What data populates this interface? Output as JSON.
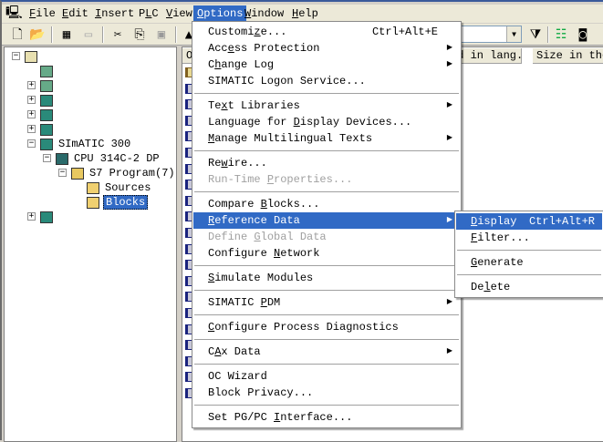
{
  "menubar": [
    "&File",
    "&Edit",
    "&Insert",
    "P&LC",
    "&View",
    "&Options",
    "&Window",
    "&Help"
  ],
  "active_menu": "Options",
  "toolbar": {
    "filter_value": ""
  },
  "tree": {
    "items": [
      {
        "label": "",
        "level": 0,
        "exp": "-",
        "icon": "project-icon"
      },
      {
        "label": "",
        "level": 1,
        "exp": "",
        "icon": "network-icon"
      },
      {
        "label": "",
        "level": 1,
        "exp": "+",
        "icon": "network-icon"
      },
      {
        "label": "",
        "level": 1,
        "exp": "+",
        "icon": "station-icon"
      },
      {
        "label": "",
        "level": 1,
        "exp": "+",
        "icon": "station-icon"
      },
      {
        "label": "",
        "level": 1,
        "exp": "+",
        "icon": "station-icon"
      },
      {
        "label": "SImATIC 300",
        "level": 1,
        "exp": "-",
        "icon": "station-icon"
      },
      {
        "label": "CPU 314C-2 DP",
        "level": 2,
        "exp": "-",
        "icon": "cpu-icon"
      },
      {
        "label": "S7 Program(7)",
        "level": 3,
        "exp": "-",
        "icon": "s7-program-icon"
      },
      {
        "label": "Sources",
        "level": 4,
        "exp": "",
        "icon": "sources-folder-icon"
      },
      {
        "label": "Blocks",
        "level": 4,
        "exp": "",
        "icon": "blocks-folder-icon",
        "selected": true
      },
      {
        "label": "",
        "level": 1,
        "exp": "+",
        "icon": "station-icon"
      }
    ]
  },
  "list": {
    "columns": [
      "OT",
      "ed in lang...",
      "Size in the"
    ],
    "rows": 21
  },
  "options_menu": [
    {
      "label": "Customi&ze...",
      "shortcut": "Ctrl+Alt+E"
    },
    {
      "label": "Acc&ess Protection",
      "submenu": true
    },
    {
      "label": "C&hange Log",
      "submenu": true
    },
    {
      "label": "SIMATIC Logon Service..."
    },
    {
      "sep": true
    },
    {
      "label": "Te&xt Libraries",
      "submenu": true
    },
    {
      "label": "Language for &Display Devices..."
    },
    {
      "label": "&Manage Multilingual Texts",
      "submenu": true
    },
    {
      "sep": true
    },
    {
      "label": "Re&wire..."
    },
    {
      "label": "Run-Time &Properties...",
      "disabled": true
    },
    {
      "sep": true
    },
    {
      "label": "Compare &Blocks..."
    },
    {
      "label": "&Reference Data",
      "submenu": true,
      "highlighted": true
    },
    {
      "label": "Define &Global Data",
      "disabled": true
    },
    {
      "label": "Configure &Network"
    },
    {
      "sep": true
    },
    {
      "label": "&Simulate Modules"
    },
    {
      "sep": true
    },
    {
      "label": "SIMATIC &PDM",
      "submenu": true
    },
    {
      "sep": true
    },
    {
      "label": "&Configure Process Diagnostics"
    },
    {
      "sep": true
    },
    {
      "label": "C&Ax Data",
      "submenu": true
    },
    {
      "sep": true
    },
    {
      "label": "OC Wizard"
    },
    {
      "label": "Block Privacy..."
    },
    {
      "sep": true
    },
    {
      "label": "Set PG/PC &Interface..."
    }
  ],
  "reference_submenu": [
    {
      "label": "&Display",
      "shortcut": "Ctrl+Alt+R",
      "highlighted": true
    },
    {
      "label": "&Filter..."
    },
    {
      "sep": true
    },
    {
      "label": "&Generate"
    },
    {
      "sep": true
    },
    {
      "label": "De&lete"
    }
  ],
  "colors": {
    "highlight": "#316ac5",
    "menubar": "#ece9d8",
    "disabled": "#a0a0a0"
  }
}
